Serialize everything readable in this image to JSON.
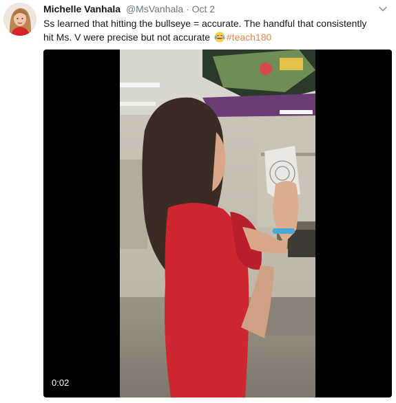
{
  "tweet": {
    "display_name": "Michelle Vanhala",
    "handle": "@MsVanhala",
    "separator": "·",
    "timestamp": "Oct 2",
    "text_line1": "Ss learned that hitting the bullseye = accurate. The handful that consistently",
    "text_line2_prefix": "hit Ms. V were precise but not accurate",
    "emoji": "face-with-tears-of-joy",
    "hashtag": "#teach180",
    "avatar_icon": "profile-photo",
    "menu_icon": "chevron-down-icon"
  },
  "video": {
    "time": "0:02",
    "frame_description_icon": "video-frame"
  },
  "colors": {
    "link": "#e0874a",
    "text": "#14171a",
    "muted": "#657786",
    "video_bg": "#000000"
  }
}
